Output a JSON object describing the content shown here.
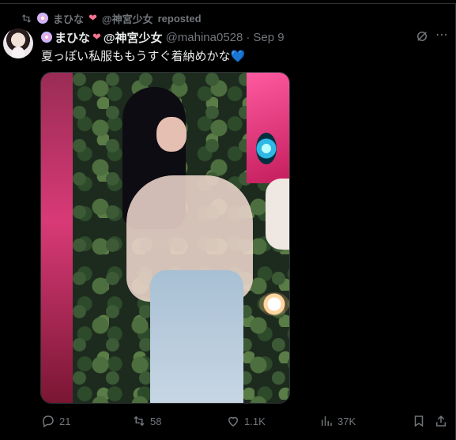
{
  "repost": {
    "name": "まひな",
    "suffix": "@神宮少女",
    "label": "reposted"
  },
  "post": {
    "display_name": "まひな",
    "display_suffix": "@神宮少女",
    "handle": "@mahina0528",
    "separator": "·",
    "date": "Sep 9",
    "text": "夏っぽい私服ももうすぐ着納めかな",
    "text_emoji": "💙"
  },
  "actions": {
    "replies": "21",
    "reposts": "58",
    "likes": "1.1K",
    "views": "37K"
  },
  "colors": {
    "background": "#000000",
    "primary_text": "#e7e9ea",
    "secondary_text": "#71767b",
    "border": "#2f3336"
  },
  "icons": [
    "repost-icon",
    "flower-emoji",
    "heart-emoji",
    "grok-icon",
    "more-icon",
    "reply-icon",
    "like-icon",
    "views-icon",
    "bookmark-icon",
    "share-icon"
  ]
}
